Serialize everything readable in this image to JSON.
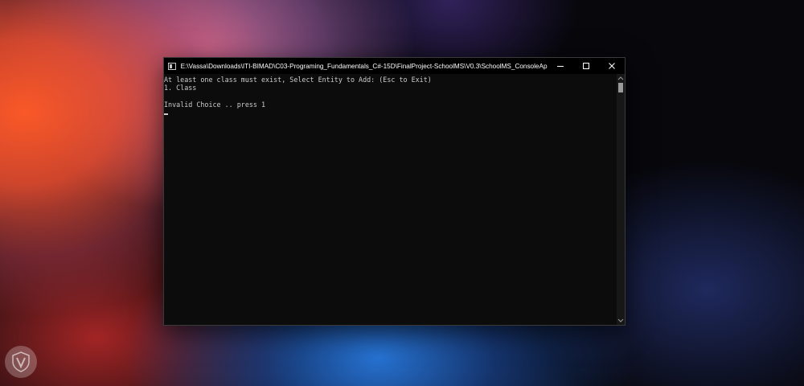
{
  "window": {
    "title": "E:\\Vassa\\Downloads\\ITI-BIMAD\\C03-Programing_Fundamentals_C#-15D\\FinalProject-SchoolMS\\V0.3\\SchoolMS_ConsoleApp.exe",
    "app_icon": "console-app-icon",
    "controls": [
      "minimize",
      "maximize",
      "close"
    ]
  },
  "console": {
    "lines": [
      "At least one class must exist, Select Entity to Add: (Esc to Exit)",
      "1. Class",
      "",
      "Invalid Choice .. press 1",
      ""
    ],
    "text_color": "#cccccc",
    "background": "#0c0c0c"
  },
  "desktop": {
    "watermark": "shield-logo"
  }
}
